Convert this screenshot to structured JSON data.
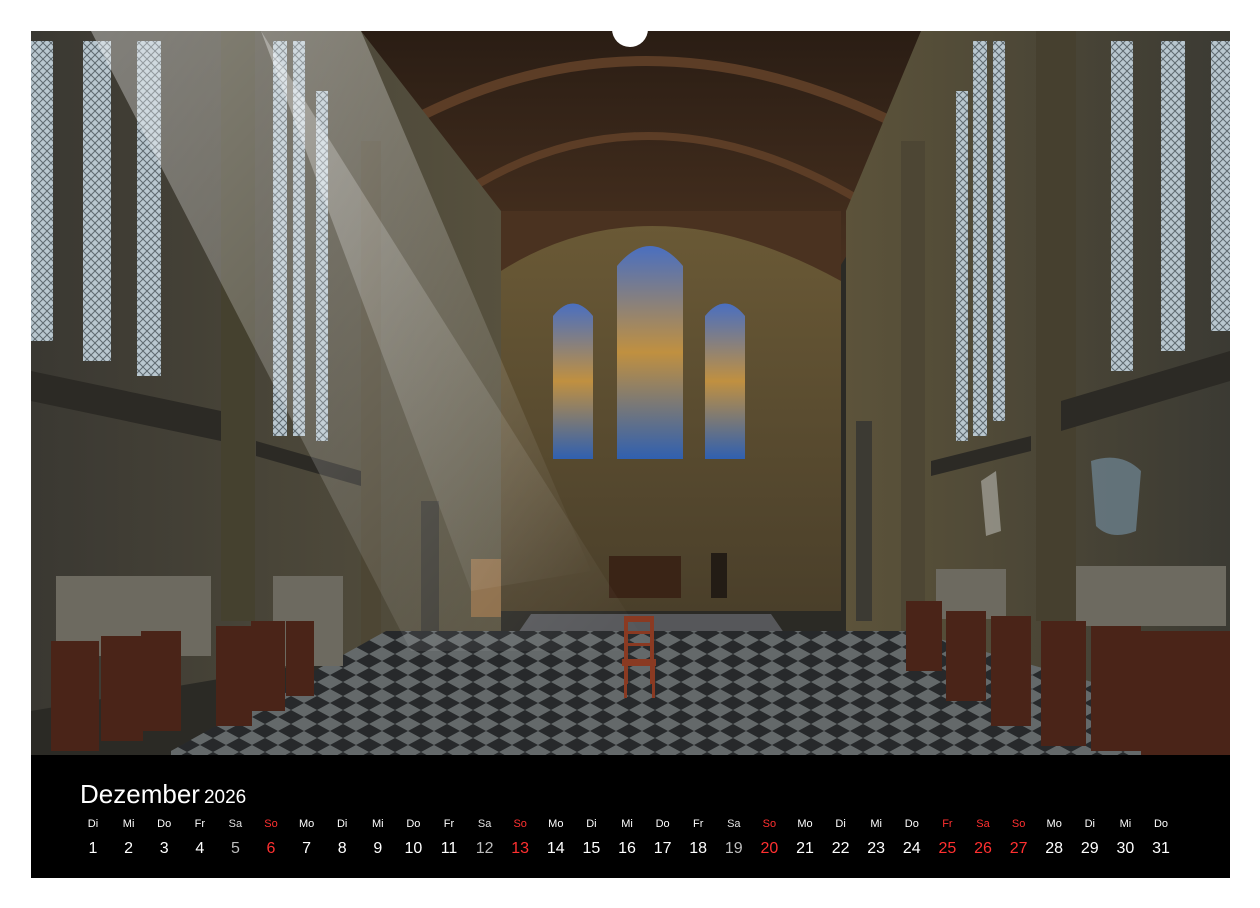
{
  "calendar": {
    "month": "Dezember",
    "year": "2026",
    "days": [
      {
        "wd": "Di",
        "d": "1",
        "style": "normal"
      },
      {
        "wd": "Mi",
        "d": "2",
        "style": "normal"
      },
      {
        "wd": "Do",
        "d": "3",
        "style": "normal"
      },
      {
        "wd": "Fr",
        "d": "4",
        "style": "normal"
      },
      {
        "wd": "Sa",
        "d": "5",
        "style": "grey"
      },
      {
        "wd": "So",
        "d": "6",
        "style": "red"
      },
      {
        "wd": "Mo",
        "d": "7",
        "style": "normal"
      },
      {
        "wd": "Di",
        "d": "8",
        "style": "normal"
      },
      {
        "wd": "Mi",
        "d": "9",
        "style": "normal"
      },
      {
        "wd": "Do",
        "d": "10",
        "style": "normal"
      },
      {
        "wd": "Fr",
        "d": "11",
        "style": "normal"
      },
      {
        "wd": "Sa",
        "d": "12",
        "style": "grey"
      },
      {
        "wd": "So",
        "d": "13",
        "style": "red"
      },
      {
        "wd": "Mo",
        "d": "14",
        "style": "normal"
      },
      {
        "wd": "Di",
        "d": "15",
        "style": "normal"
      },
      {
        "wd": "Mi",
        "d": "16",
        "style": "normal"
      },
      {
        "wd": "Do",
        "d": "17",
        "style": "normal"
      },
      {
        "wd": "Fr",
        "d": "18",
        "style": "normal"
      },
      {
        "wd": "Sa",
        "d": "19",
        "style": "grey"
      },
      {
        "wd": "So",
        "d": "20",
        "style": "red"
      },
      {
        "wd": "Mo",
        "d": "21",
        "style": "normal"
      },
      {
        "wd": "Di",
        "d": "22",
        "style": "normal"
      },
      {
        "wd": "Mi",
        "d": "23",
        "style": "normal"
      },
      {
        "wd": "Do",
        "d": "24",
        "style": "normal"
      },
      {
        "wd": "Fr",
        "d": "25",
        "style": "red"
      },
      {
        "wd": "Sa",
        "d": "26",
        "style": "red"
      },
      {
        "wd": "So",
        "d": "27",
        "style": "red"
      },
      {
        "wd": "Mo",
        "d": "28",
        "style": "normal"
      },
      {
        "wd": "Di",
        "d": "29",
        "style": "normal"
      },
      {
        "wd": "Mi",
        "d": "30",
        "style": "normal"
      },
      {
        "wd": "Do",
        "d": "31",
        "style": "normal"
      }
    ]
  },
  "colors": {
    "band": "#000000",
    "text": "#ffffff",
    "holiday": "#ff3030",
    "saturday": "#bdbdbd"
  }
}
